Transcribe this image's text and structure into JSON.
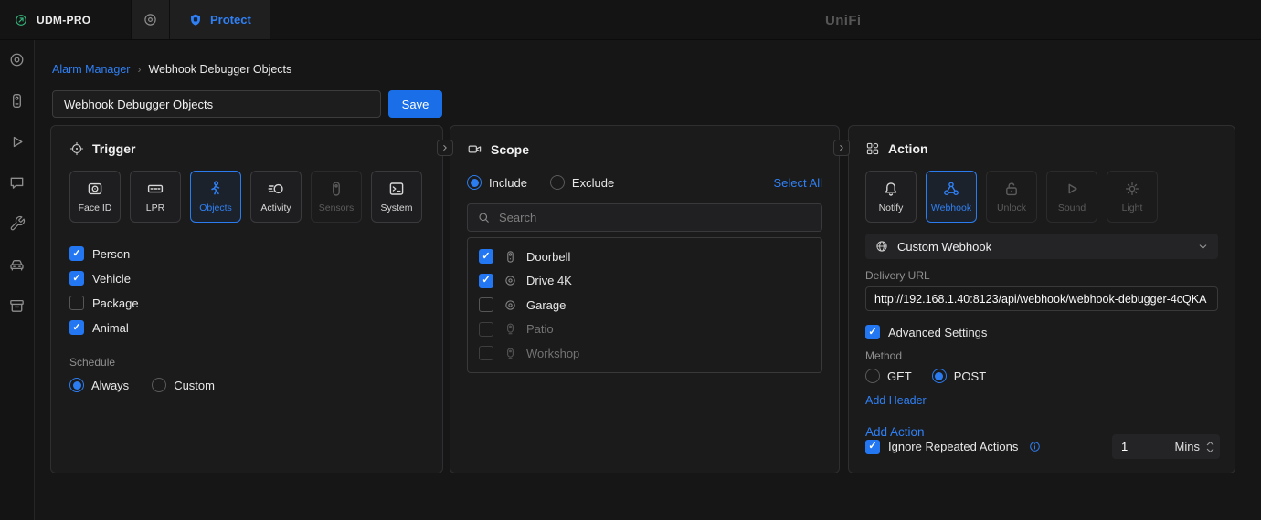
{
  "theme": {
    "accent": "#2b7cf0",
    "link": "#2f80f5",
    "save_bg": "#1a6fe8"
  },
  "topbar": {
    "device_name": "UDM-PRO",
    "app_tab": "Protect",
    "logo": "UniFi"
  },
  "sidebar": {
    "icons": [
      "lens-icon",
      "doorbell-icon",
      "playback-icon",
      "detections-icon",
      "tools-icon",
      "vehicle-icon",
      "archive-icon"
    ]
  },
  "breadcrumb": {
    "parent": "Alarm Manager",
    "separator": "›",
    "current": "Webhook Debugger Objects"
  },
  "name_field": {
    "value": "Webhook Debugger Objects"
  },
  "save_button": "Save",
  "trigger": {
    "title": "Trigger",
    "tiles": [
      {
        "label": "Face ID",
        "state": "normal"
      },
      {
        "label": "LPR",
        "state": "normal"
      },
      {
        "label": "Objects",
        "state": "selected"
      },
      {
        "label": "Activity",
        "state": "normal"
      },
      {
        "label": "Sensors",
        "state": "disabled"
      },
      {
        "label": "System",
        "state": "normal"
      }
    ],
    "checkboxes": [
      {
        "label": "Person",
        "checked": true
      },
      {
        "label": "Vehicle",
        "checked": true
      },
      {
        "label": "Package",
        "checked": false
      },
      {
        "label": "Animal",
        "checked": true
      }
    ],
    "schedule_label": "Schedule",
    "schedule_options": [
      {
        "label": "Always",
        "selected": true
      },
      {
        "label": "Custom",
        "selected": false
      }
    ]
  },
  "scope": {
    "title": "Scope",
    "mode_options": [
      {
        "label": "Include",
        "selected": true
      },
      {
        "label": "Exclude",
        "selected": false
      }
    ],
    "select_all": "Select All",
    "search_placeholder": "Search",
    "devices": [
      {
        "label": "Doorbell",
        "checked": true,
        "dimmed": false
      },
      {
        "label": "Drive 4K",
        "checked": true,
        "dimmed": false
      },
      {
        "label": "Garage",
        "checked": false,
        "dimmed": false
      },
      {
        "label": "Patio",
        "checked": false,
        "dimmed": true
      },
      {
        "label": "Workshop",
        "checked": false,
        "dimmed": true
      }
    ]
  },
  "action": {
    "title": "Action",
    "tiles": [
      {
        "label": "Notify",
        "state": "normal"
      },
      {
        "label": "Webhook",
        "state": "selected"
      },
      {
        "label": "Unlock",
        "state": "disabled"
      },
      {
        "label": "Sound",
        "state": "disabled"
      },
      {
        "label": "Light",
        "state": "disabled"
      }
    ],
    "webhook_select": "Custom Webhook",
    "delivery_url_label": "Delivery URL",
    "delivery_url_value": "http://192.168.1.40:8123/api/webhook/webhook-debugger-4cQKA",
    "advanced_settings": {
      "label": "Advanced Settings",
      "checked": true
    },
    "method_label": "Method",
    "method_options": [
      {
        "label": "GET",
        "selected": false
      },
      {
        "label": "POST",
        "selected": true
      }
    ],
    "add_header": "Add Header",
    "add_action": "Add Action",
    "ignore_repeated": {
      "label": "Ignore Repeated Actions",
      "checked": true
    },
    "interval": {
      "value": "1",
      "unit": "Mins"
    }
  }
}
